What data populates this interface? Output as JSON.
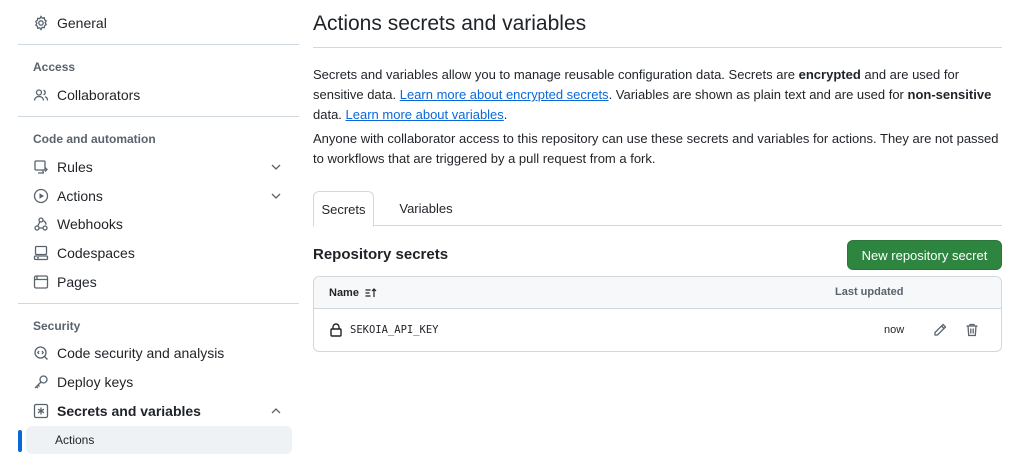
{
  "sidebar": {
    "general": "General",
    "access_heading": "Access",
    "collaborators": "Collaborators",
    "code_heading": "Code and automation",
    "rules": "Rules",
    "actions": "Actions",
    "webhooks": "Webhooks",
    "codespaces": "Codespaces",
    "pages": "Pages",
    "security_heading": "Security",
    "code_security": "Code security and analysis",
    "deploy_keys": "Deploy keys",
    "secrets_vars": "Secrets and variables",
    "sub_actions": "Actions"
  },
  "main": {
    "title": "Actions secrets and variables",
    "para1": {
      "t1": "Secrets and variables allow you to manage reusable configuration data. Secrets are ",
      "b1": "encrypted",
      "t2": " and are used for sensitive data. ",
      "link1": "Learn more about encrypted secrets",
      "t3": ". Variables are shown as plain text and are used for ",
      "b2": "non-sensitive",
      "t4": " data. ",
      "link2": "Learn more about variables",
      "t5": "."
    },
    "para2": "Anyone with collaborator access to this repository can use these secrets and variables for actions. They are not passed to workflows that are triggered by a pull request from a fork.",
    "tabs": [
      "Secrets",
      "Variables"
    ],
    "section_title": "Repository secrets",
    "new_button": "New repository secret",
    "table": {
      "col_name": "Name",
      "col_updated": "Last updated",
      "rows": [
        {
          "name": "SEKOIA_API_KEY",
          "updated": "now"
        }
      ]
    }
  },
  "colors": {
    "accent_link": "#0969da",
    "primary_button": "#2e8540",
    "active_indicator": "#0969da"
  }
}
